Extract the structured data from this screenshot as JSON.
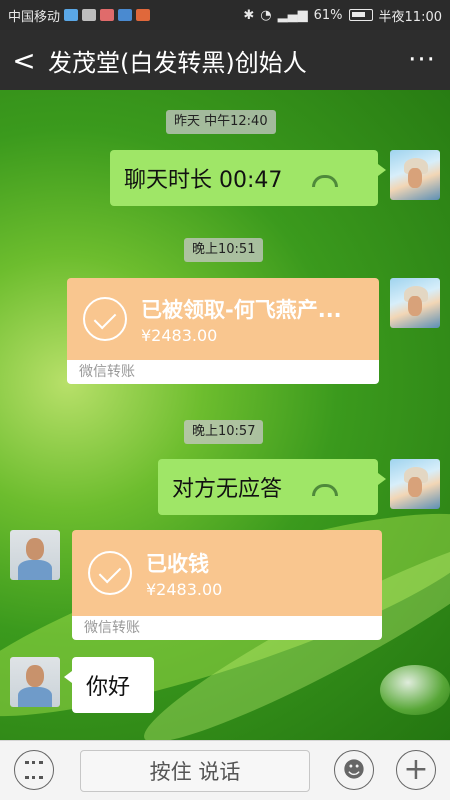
{
  "status_bar": {
    "carrier": "中国移动",
    "battery": "61%",
    "time": "半夜11:00"
  },
  "header": {
    "back_label": "<",
    "title": "发茂堂(白发转黑)创始人",
    "more_label": "···"
  },
  "messages": {
    "ts1": "昨天 中午12:40",
    "call1": "聊天时长 00:47",
    "ts2": "晚上10:51",
    "transfer1": {
      "title": "已被领取-何飞燕产...",
      "amount": "¥2483.00",
      "footer": "微信转账"
    },
    "ts3": "晚上10:57",
    "call2": "对方无应答",
    "transfer2": {
      "title": "已收钱",
      "amount": "¥2483.00",
      "footer": "微信转账"
    },
    "text1": "你好"
  },
  "input_bar": {
    "hold_label": "按住 说话",
    "emoji_glyph": "☻",
    "plus_glyph": "+"
  },
  "colors": {
    "my_bubble": "#9fe667",
    "transfer_card": "#f9c68f",
    "title_bar": "#2d2d2d"
  }
}
